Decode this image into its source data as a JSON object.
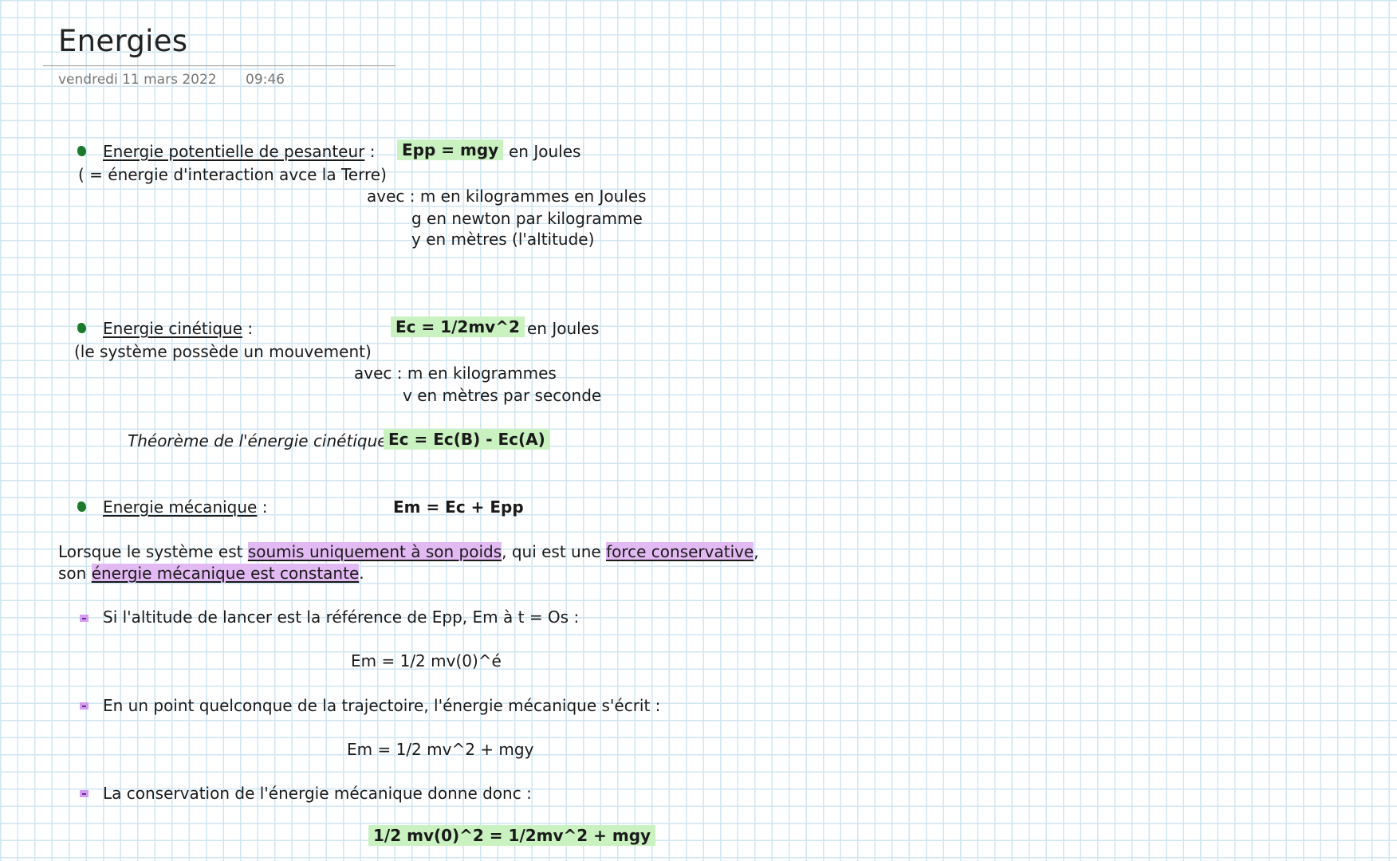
{
  "header": {
    "title": "Energies",
    "date": "vendredi 11 mars 2022",
    "time": "09:46"
  },
  "section_epp": {
    "heading": "Energie potentielle de pesanteur",
    "heading_suffix": ":",
    "subtitle": "( = énergie d'interaction avce la Terre)",
    "formula": "Epp = mgy",
    "unit": "en Joules",
    "avec_line1": "avec : m en kilogrammes    en Joules",
    "avec_line2": "g  en newton par kilogramme",
    "avec_line3": "y  en mètres (l'altitude)"
  },
  "section_ec": {
    "heading": "Energie cinétique",
    "heading_suffix": ":",
    "subtitle": "(le système possède un mouvement)",
    "formula": "Ec = 1/2mv^2",
    "unit": "en Joules",
    "avec_line1": "avec :  m en kilogrammes",
    "avec_line2": "v en mètres par seconde",
    "theorem_label": "Théorème de l'énergie cinétique :",
    "theorem_formula": "Ec = Ec(B) - Ec(A)"
  },
  "section_em": {
    "heading": "Energie mécanique",
    "heading_suffix": ":",
    "formula": "Em = Ec + Epp",
    "para_part1": "Lorsque le système est ",
    "para_hl1": "soumis uniquement à son poids",
    "para_part2": ", qui est une ",
    "para_hl2": "force conservative",
    "para_part3": ",",
    "para_line2_part1": "son ",
    "para_hl3": "énergie mécanique est constante",
    "para_line2_end": ".",
    "items": [
      {
        "text": "Si l'altitude de lancer est la référence de Epp, Em à t = Os :",
        "formula": "Em = 1/2 mv(0)^é"
      },
      {
        "text": "En un point quelconque de la trajectoire, l'énergie mécanique s'écrit :",
        "formula": "Em = 1/2 mv^2 + mgy"
      },
      {
        "text": "La conservation de l'énergie mécanique donne donc :",
        "formula": "1/2 mv(0)^2 = 1/2mv^2 + mgy"
      }
    ]
  },
  "colors": {
    "grid": "#cfe6f2",
    "green_highlight": "#c9f2c0",
    "purple_highlight": "#e2b9f2",
    "green_bullet": "#1d7a2c",
    "purple_bullet": "#d49cf0"
  }
}
